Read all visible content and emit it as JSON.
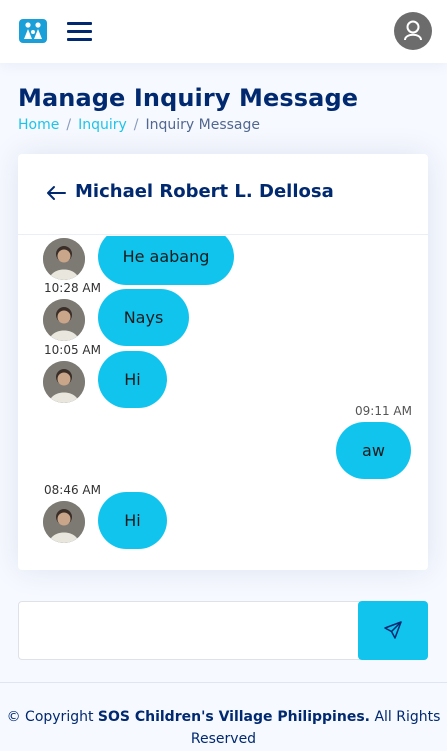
{
  "header": {
    "logo_icon": "sos-children-logo-icon",
    "menu_icon": "hamburger-menu-icon",
    "profile_icon": "user-profile-icon"
  },
  "page": {
    "title": "Manage Inquiry Message",
    "breadcrumb": [
      "Home",
      "Inquiry",
      "Inquiry Message"
    ]
  },
  "chat": {
    "contact_name": "Michael Robert L. Dellosa",
    "back_icon": "arrow-left-icon",
    "messages": [
      {
        "side": "left",
        "text": "He aabang",
        "time": ""
      },
      {
        "side": "left",
        "text": "Nays",
        "time": "10:28 AM"
      },
      {
        "side": "left",
        "text": "Hi",
        "time": "10:05 AM"
      },
      {
        "side": "right",
        "text": "aw",
        "time": "09:11 AM"
      },
      {
        "side": "left",
        "text": "Hi",
        "time": "08:46 AM"
      }
    ]
  },
  "composer": {
    "placeholder": "",
    "send_icon": "send-icon"
  },
  "footer": {
    "prefix": "© Copyright",
    "org": "SOS Children's Village Philippines.",
    "suffix": "All Rights Reserved"
  },
  "colors": {
    "accent": "#11c4ee",
    "navy": "#012970",
    "background": "#f6f9ff"
  }
}
